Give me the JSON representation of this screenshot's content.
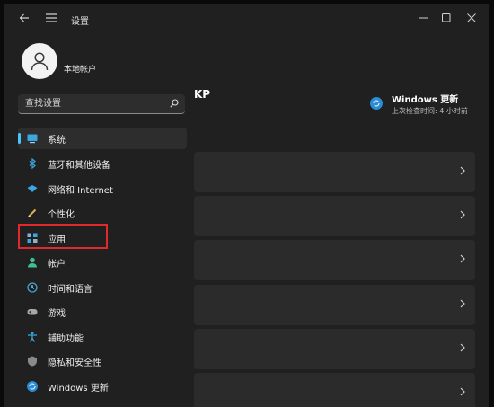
{
  "app": {
    "title": "设置"
  },
  "account": {
    "name": "本地帐户"
  },
  "search": {
    "placeholder": "查找设置"
  },
  "nav": {
    "items": [
      {
        "label": "系统",
        "icon": "monitor-icon"
      },
      {
        "label": "蓝牙和其他设备",
        "icon": "bluetooth-icon"
      },
      {
        "label": "网络和 Internet",
        "icon": "wifi-icon"
      },
      {
        "label": "个性化",
        "icon": "brush-icon"
      },
      {
        "label": "应用",
        "icon": "apps-icon"
      },
      {
        "label": "帐户",
        "icon": "account-icon"
      },
      {
        "label": "时间和语言",
        "icon": "globe-clock-icon"
      },
      {
        "label": "游戏",
        "icon": "gamepad-icon"
      },
      {
        "label": "辅助功能",
        "icon": "accessibility-icon"
      },
      {
        "label": "隐私和安全性",
        "icon": "shield-icon"
      },
      {
        "label": "Windows 更新",
        "icon": "update-icon"
      }
    ],
    "selected": "系统",
    "highlighted": "应用"
  },
  "main": {
    "title": "KP",
    "update": {
      "title": "Windows 更新",
      "subtitle": "上次检查时间: 4 小时前"
    },
    "cards": 6
  },
  "colors": {
    "accent": "#4cc2ff",
    "highlight": "#e0282d",
    "background": "#202020",
    "card": "#2b2b2b"
  }
}
